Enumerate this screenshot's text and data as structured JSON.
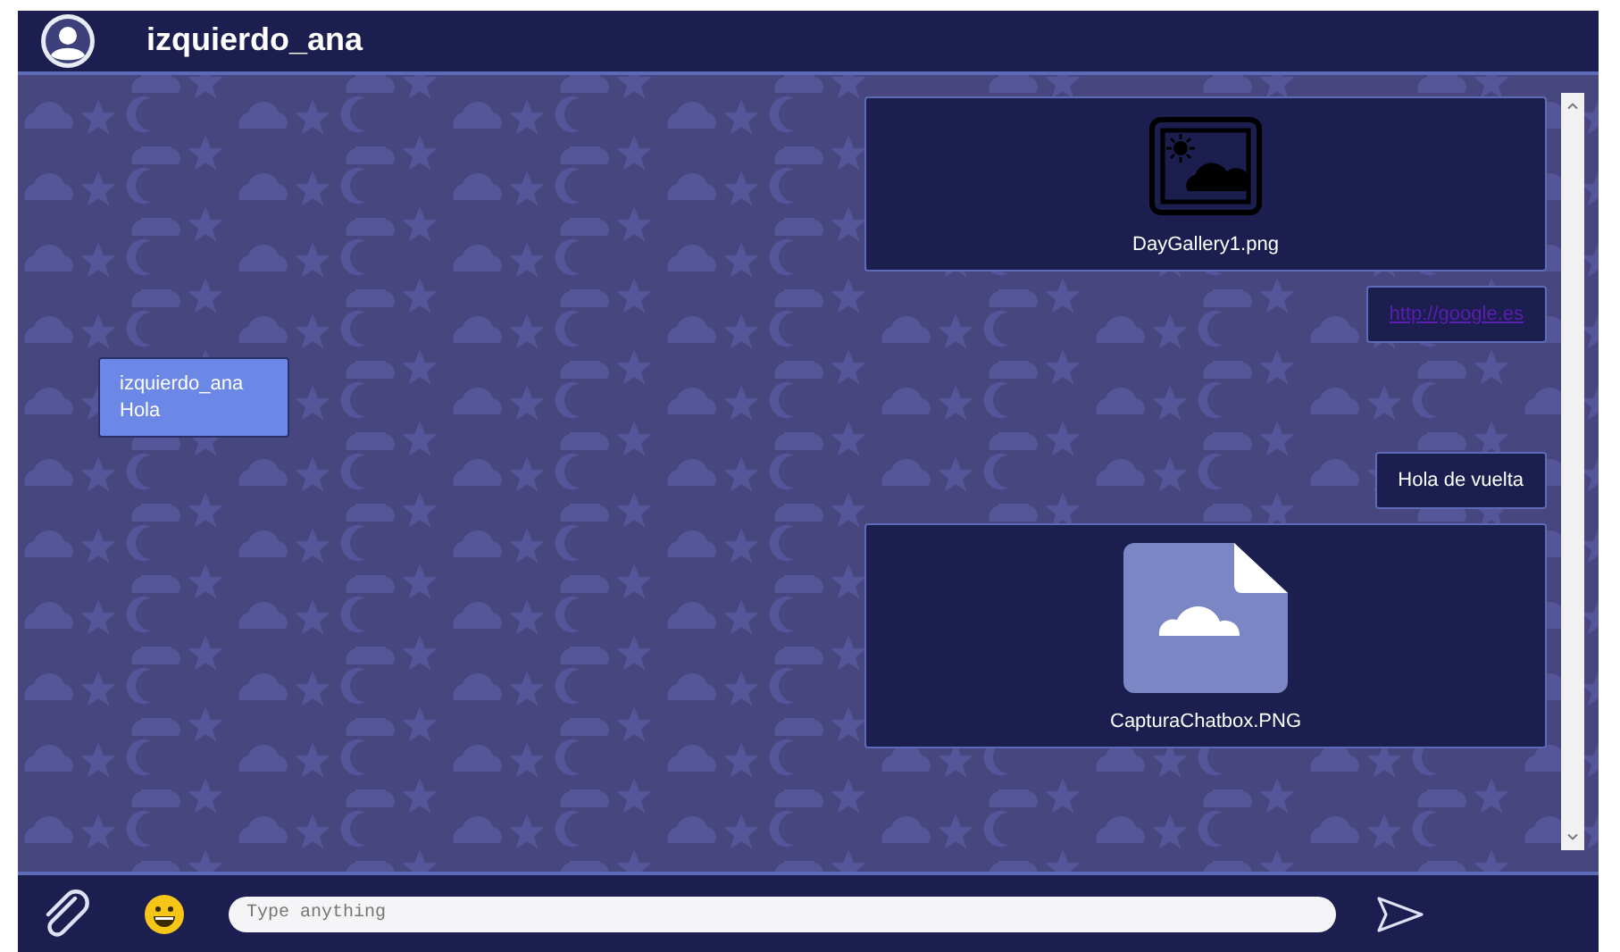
{
  "header": {
    "title": "izquierdo_ana"
  },
  "messages": [
    {
      "kind": "image",
      "filename": "DayGallery1.png"
    },
    {
      "kind": "link",
      "text": "http://google.es"
    },
    {
      "kind": "received",
      "sender": "izquierdo_ana",
      "text": "Hola"
    },
    {
      "kind": "text",
      "text": "Hola de vuelta"
    },
    {
      "kind": "document",
      "filename": "CapturaChatbox.PNG"
    }
  ],
  "composer": {
    "placeholder": "Type anything"
  }
}
